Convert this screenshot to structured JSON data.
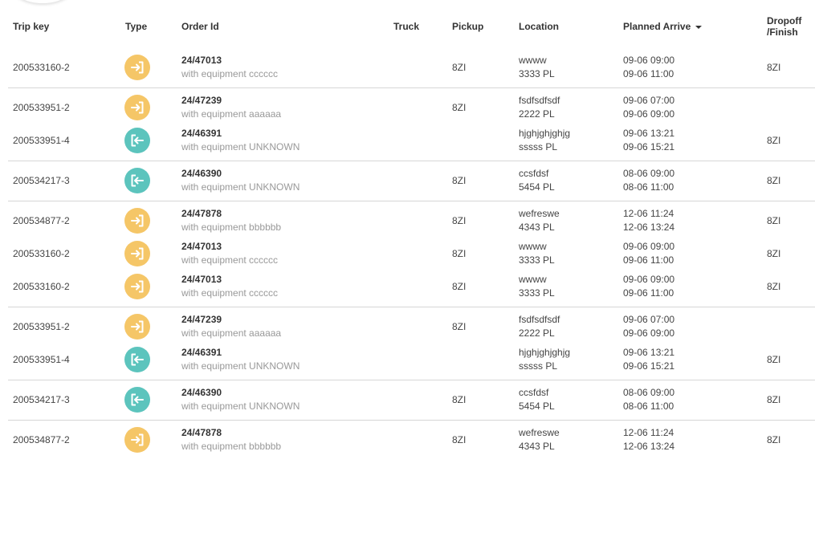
{
  "columns": {
    "trip_key": "Trip key",
    "type": "Type",
    "order_id": "Order Id",
    "truck": "Truck",
    "pickup": "Pickup",
    "location": "Location",
    "planned_arrive": "Planned Arrive",
    "dropoff_line1": "Dropoff",
    "dropoff_line2": "/Finish"
  },
  "colors": {
    "pickup_icon": "#f5c667",
    "dropoff_icon": "#5cc4bd"
  },
  "groups": [
    {
      "rows": [
        {
          "trip": "200533160-2",
          "type": "enter-icon",
          "order": "24/47013",
          "equip": "with equipment cccccc",
          "pickup": "8ZI",
          "loc1": "wwww",
          "loc2": "3333 PL",
          "arr1": "09-06 09:00",
          "arr2": "09-06 11:00",
          "drop": "8ZI"
        }
      ]
    },
    {
      "rows": [
        {
          "trip": "200533951-2",
          "type": "enter-icon",
          "order": "24/47239",
          "equip": "with equipment aaaaaa",
          "pickup": "8ZI",
          "loc1": "fsdfsdfsdf",
          "loc2": "2222 PL",
          "arr1": "09-06 07:00",
          "arr2": "09-06 09:00",
          "drop": ""
        },
        {
          "trip": "200533951-4",
          "type": "exit-icon",
          "order": "24/46391",
          "equip": "with equipment UNKNOWN",
          "pickup": "",
          "loc1": "hjghjghjghjg",
          "loc2": "sssss PL",
          "arr1": "09-06 13:21",
          "arr2": "09-06 15:21",
          "drop": "8ZI"
        }
      ]
    },
    {
      "rows": [
        {
          "trip": "200534217-3",
          "type": "exit-icon",
          "order": "24/46390",
          "equip": "with equipment UNKNOWN",
          "pickup": "8ZI",
          "loc1": "ccsfdsf",
          "loc2": "5454 PL",
          "arr1": "08-06 09:00",
          "arr2": "08-06 11:00",
          "drop": "8ZI"
        }
      ]
    },
    {
      "rows": [
        {
          "trip": "200534877-2",
          "type": "enter-icon",
          "order": "24/47878",
          "equip": "with equipment bbbbbb",
          "pickup": "8ZI",
          "loc1": "wefreswe",
          "loc2": "4343 PL",
          "arr1": "12-06 11:24",
          "arr2": "12-06 13:24",
          "drop": "8ZI"
        },
        {
          "trip": "200533160-2",
          "type": "enter-icon",
          "order": "24/47013",
          "equip": "with equipment cccccc",
          "pickup": "8ZI",
          "loc1": "wwww",
          "loc2": "3333 PL",
          "arr1": "09-06 09:00",
          "arr2": "09-06 11:00",
          "drop": "8ZI"
        },
        {
          "trip": "200533160-2",
          "type": "enter-icon",
          "order": "24/47013",
          "equip": "with equipment cccccc",
          "pickup": "8ZI",
          "loc1": "wwww",
          "loc2": "3333 PL",
          "arr1": "09-06 09:00",
          "arr2": "09-06 11:00",
          "drop": "8ZI"
        }
      ]
    },
    {
      "rows": [
        {
          "trip": "200533951-2",
          "type": "enter-icon",
          "order": "24/47239",
          "equip": "with equipment aaaaaa",
          "pickup": "8ZI",
          "loc1": "fsdfsdfsdf",
          "loc2": "2222 PL",
          "arr1": "09-06 07:00",
          "arr2": "09-06 09:00",
          "drop": ""
        },
        {
          "trip": "200533951-4",
          "type": "exit-icon",
          "order": "24/46391",
          "equip": "with equipment UNKNOWN",
          "pickup": "",
          "loc1": "hjghjghjghjg",
          "loc2": "sssss PL",
          "arr1": "09-06 13:21",
          "arr2": "09-06 15:21",
          "drop": "8ZI"
        }
      ]
    },
    {
      "rows": [
        {
          "trip": "200534217-3",
          "type": "exit-icon",
          "order": "24/46390",
          "equip": "with equipment UNKNOWN",
          "pickup": "8ZI",
          "loc1": "ccsfdsf",
          "loc2": "5454 PL",
          "arr1": "08-06 09:00",
          "arr2": "08-06 11:00",
          "drop": "8ZI"
        }
      ]
    },
    {
      "rows": [
        {
          "trip": "200534877-2",
          "type": "enter-icon",
          "order": "24/47878",
          "equip": "with equipment bbbbbb",
          "pickup": "8ZI",
          "loc1": "wefreswe",
          "loc2": "4343 PL",
          "arr1": "12-06 11:24",
          "arr2": "12-06 13:24",
          "drop": "8ZI"
        }
      ]
    }
  ]
}
